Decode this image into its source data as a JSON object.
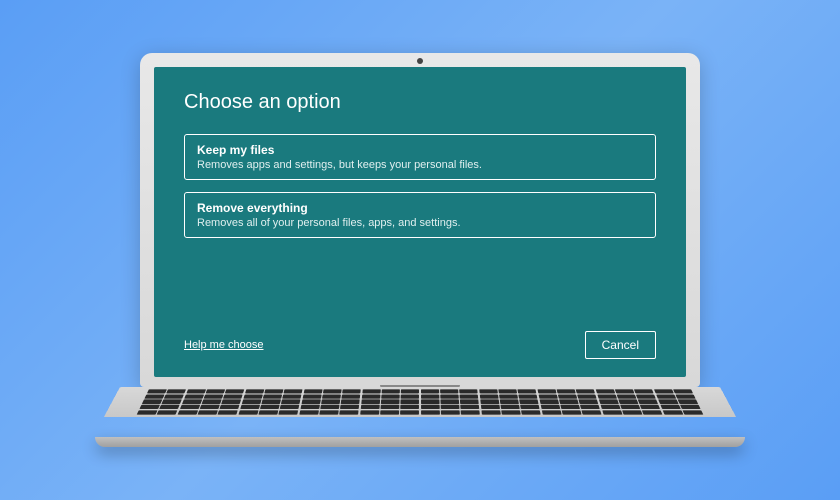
{
  "dialog": {
    "title": "Choose an option",
    "options": [
      {
        "title": "Keep my files",
        "description": "Removes apps and settings, but keeps your personal files."
      },
      {
        "title": "Remove everything",
        "description": "Removes all of your personal files, apps, and settings."
      }
    ],
    "help_link": "Help me choose",
    "cancel_label": "Cancel"
  }
}
